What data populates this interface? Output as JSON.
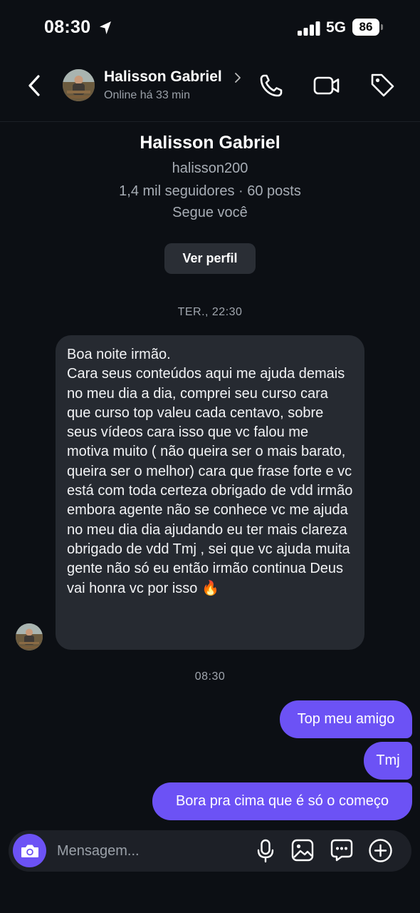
{
  "status_bar": {
    "time": "08:30",
    "network": "5G",
    "battery": "86"
  },
  "header": {
    "name": "Halisson Gabriel",
    "status": "Online há 33 min",
    "icons": [
      "back-icon",
      "chevron-right-icon",
      "phone-icon",
      "video-icon",
      "tag-icon"
    ]
  },
  "profile": {
    "name": "Halisson Gabriel",
    "username": "halisson200",
    "stats": "1,4 mil seguidores · 60 posts",
    "follow_status": "Segue você",
    "view_button": "Ver perfil"
  },
  "messages": {
    "timestamp_1": "TER., 22:30",
    "incoming_1": "Boa noite irmão.\nCara seus conteúdos aqui me ajuda demais no meu dia a dia, comprei seu curso cara que curso top valeu cada centavo, sobre seus vídeos cara isso que vc falou me motiva muito ( não queira ser o mais barato, queira ser o melhor) cara que frase forte e vc está com toda certeza obrigado de vdd irmão embora agente não se conhece vc me ajuda no meu dia dia ajudando eu ter mais clareza obrigado de vdd Tmj , sei que vc ajuda muita gente não só eu então irmão continua Deus vai honra vc por isso 🔥",
    "timestamp_2": "08:30",
    "outgoing": [
      "Top meu amigo",
      "Tmj",
      "Bora pra cima que é só o começo"
    ]
  },
  "composer": {
    "placeholder": "Mensagem...",
    "icons": [
      "camera-icon",
      "microphone-icon",
      "image-icon",
      "sticker-icon",
      "plus-icon"
    ]
  },
  "colors": {
    "background": "#0c0f14",
    "accent": "#6c52f5",
    "incoming_bubble": "#262a31"
  }
}
